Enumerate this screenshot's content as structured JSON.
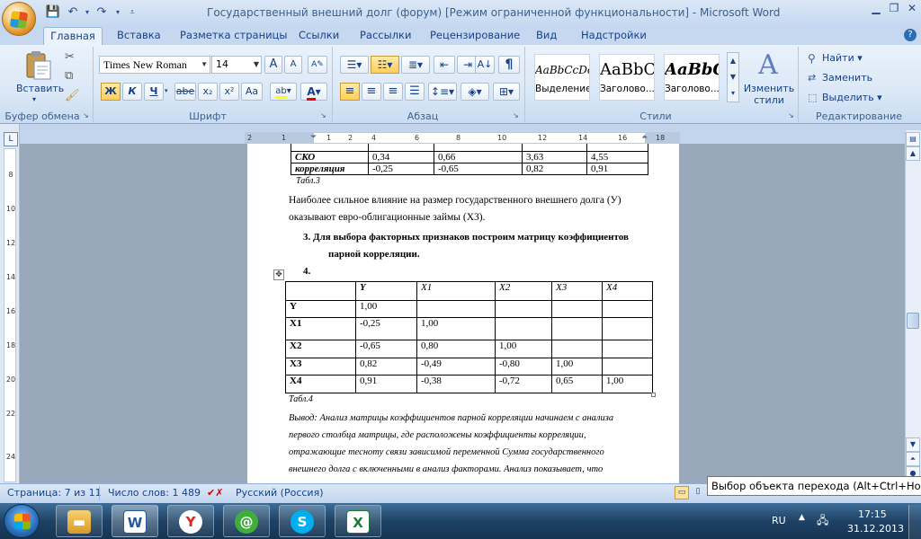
{
  "window": {
    "title": "Государственный внешний долг (форум) [Режим ограниченной функциональности] - Microsoft Word"
  },
  "tabs": [
    "Главная",
    "Вставка",
    "Разметка страницы",
    "Ссылки",
    "Рассылки",
    "Рецензирование",
    "Вид",
    "Надстройки"
  ],
  "ribbon": {
    "clipboard": {
      "paste": "Вставить",
      "label": "Буфер обмена"
    },
    "font": {
      "name": "Times New Roman",
      "size": "14",
      "bold": "Ж",
      "italic": "К",
      "underline": "Ч",
      "strike": "abe",
      "sub": "x₂",
      "sup": "x²",
      "case": "Аа",
      "grow": "A",
      "shrink": "A",
      "label": "Шрифт"
    },
    "paragraph": {
      "label": "Абзац"
    },
    "styles": {
      "cards": [
        {
          "sample": "AaBbCcDc",
          "name": "Выделение"
        },
        {
          "sample": "AaBbC",
          "name": "Заголово..."
        },
        {
          "sample": "AaBbC",
          "name": "Заголово..."
        }
      ],
      "change": "Изменить стили",
      "label": "Стили"
    },
    "editing": {
      "find": "Найти",
      "replace": "Заменить",
      "select": "Выделить",
      "label": "Редактирование"
    }
  },
  "ruler": {
    "h": [
      "2",
      "1",
      "1",
      "2",
      "4",
      "6",
      "8",
      "10",
      "12",
      "14",
      "16",
      "18"
    ],
    "v": [
      "8",
      "10",
      "12",
      "14",
      "16",
      "18",
      "20",
      "22",
      "24"
    ]
  },
  "document": {
    "table3": [
      [
        "СКО",
        "0,34",
        "0,66",
        "3,63",
        "4,55"
      ],
      [
        "корреляция",
        "-0,25",
        "-0,65",
        "0,82",
        "0,91"
      ]
    ],
    "caption3": "Табл.3",
    "para1_line1": "Наиболее сильное влияние на размер государственного внешнего долга (У)",
    "para1_line2": "оказывают  евро-облигационные займы (Х3).",
    "item3_line1": "3.  Для выбора факторных признаков  построим матрицу  коэффициентов",
    "item3_line2": "парной корреляции.",
    "item4": "4.",
    "table4": {
      "header": [
        "",
        "Y",
        "X1",
        "X2",
        "X3",
        "X4"
      ],
      "rows": [
        [
          "Y",
          "1,00",
          "",
          "",
          "",
          ""
        ],
        [
          "X1",
          "-0,25",
          "1,00",
          "",
          "",
          ""
        ],
        [
          "X2",
          "-0,65",
          "0,80",
          "1,00",
          "",
          ""
        ],
        [
          "X3",
          "0,82",
          "-0,49",
          "-0,80",
          "1,00",
          ""
        ],
        [
          "X4",
          "0,91",
          "-0,38",
          "-0,72",
          "0,65",
          "1,00"
        ]
      ]
    },
    "caption4": "Табл.4",
    "conclusion": [
      "Вывод: Анализ матрицы коэффициентов парной корреляции начинаем с анализа",
      "первого столбца матрицы, где расположены коэффициенты корреляции,",
      "отражающие тесноту связи зависимой переменной Сумма  государственного",
      "внешнего долга с включенными  в анализ факторами. Анализ показывает, что"
    ]
  },
  "status": {
    "page": "Страница: 7 из 11",
    "words": "Число слов: 1 489",
    "lang": "Русский (Россия)",
    "tooltip": "Выбор объекта перехода (Alt+Ctrl+Home)"
  },
  "taskbar": {
    "lang": "RU",
    "time": "17:15",
    "date": "31.12.2013"
  },
  "colors": {
    "ribbon": "#dbe8f7",
    "accent": "#15428b",
    "taskbar": "#1e4265"
  }
}
